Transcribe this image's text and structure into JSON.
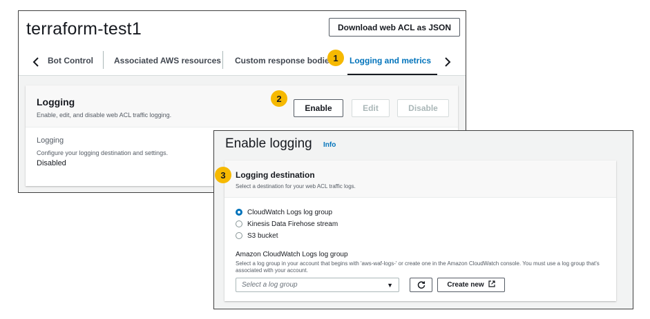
{
  "web_acl": {
    "title": "terraform-test1",
    "download_label": "Download web ACL as JSON"
  },
  "tabs": {
    "items": [
      {
        "label": "Bot Control"
      },
      {
        "label": "Associated AWS resources"
      },
      {
        "label": "Custom response bodies"
      },
      {
        "label": "Logging and metrics"
      }
    ],
    "active": "Logging and metrics",
    "prev_icon": "chevron-left-icon",
    "next_icon": "chevron-right-icon"
  },
  "logging_card": {
    "title": "Logging",
    "description": "Enable, edit, and disable web ACL traffic logging.",
    "enable_label": "Enable",
    "edit_label": "Edit",
    "disable_label": "Disable",
    "field_label": "Logging",
    "field_description": "Configure your logging destination and settings.",
    "field_value": "Disabled"
  },
  "callouts": [
    "1",
    "2",
    "3"
  ],
  "enable_logging": {
    "title": "Enable logging",
    "info_label": "Info",
    "destination": {
      "title": "Logging destination",
      "description": "Select a destination for your web ACL traffic logs.",
      "options": [
        {
          "label": "CloudWatch Logs log group",
          "selected": true
        },
        {
          "label": "Kinesis Data Firehose stream",
          "selected": false
        },
        {
          "label": "S3 bucket",
          "selected": false
        }
      ]
    },
    "log_group": {
      "label": "Amazon CloudWatch Logs log group",
      "description": "Select a log group in your account that begins with 'aws-waf-logs-' or create one in the Amazon CloudWatch console. You must use a log group that's associated with your account.",
      "placeholder": "Select a log group",
      "refresh_icon": "refresh-icon",
      "create_label": "Create new",
      "external_icon": "external-link-icon"
    }
  },
  "colors": {
    "accent": "#0073bb",
    "callout": "#f6b901",
    "text": "#16191f",
    "muted": "#545b64"
  }
}
